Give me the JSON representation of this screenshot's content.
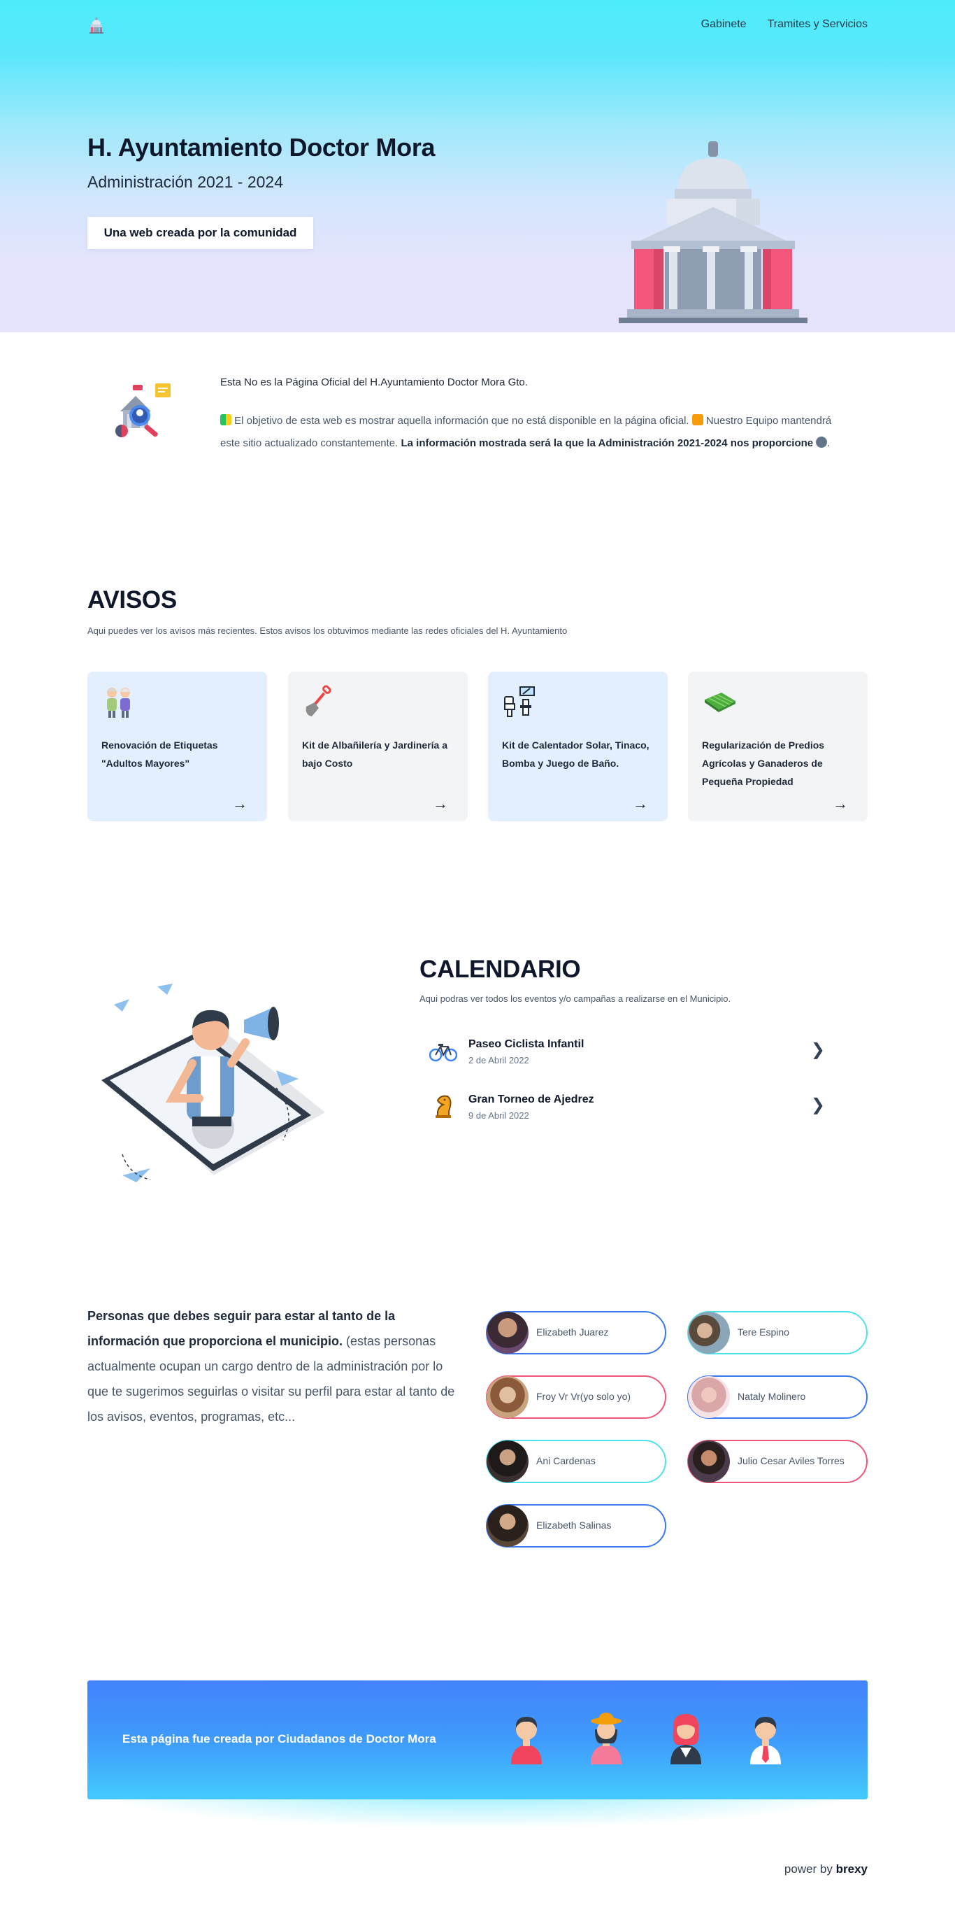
{
  "nav": {
    "logo_icon": "capitol-logo-icon",
    "links": [
      "Gabinete",
      "Tramites y Servicios"
    ]
  },
  "hero": {
    "title": "H. Ayuntamiento Doctor Mora",
    "subtitle": "Administración 2021 - 2024",
    "button": "Una web creada por la comunidad",
    "illustration": "capitol-building-icon"
  },
  "info": {
    "title": "Esta No es la Página Oficial del H.Ayuntamiento Doctor Mora Gto.",
    "body_1": "El objetivo de esta web es mostrar aquella información que no está disponible en la página oficial.",
    "body_2": "Nuestro Equipo mantendrá este sitio actualizado constantemente.",
    "body_bold": "La información mostrada será la que la Administración 2021-2024 nos proporcione",
    "body_end": "."
  },
  "avisos": {
    "title": "AVISOS",
    "subtitle": "Aqui puedes ver los avisos más recientes. Estos avisos los obtuvimos mediante las redes oficiales del H. Ayuntamiento",
    "cards": [
      {
        "label": "Renovación de Etiquetas \"Adultos Mayores\"",
        "icon": "elderly-couple-icon",
        "arrow": "→"
      },
      {
        "label": "Kit de Albañilería y Jardinería a bajo Costo",
        "icon": "shovel-icon",
        "arrow": "→"
      },
      {
        "label": "Kit de Calentador Solar, Tinaco, Bomba y Juego de Baño.",
        "icon": "bathroom-kit-icon",
        "arrow": "→"
      },
      {
        "label": "Regularización de Predios Agrícolas y Ganaderos de Pequeña Propiedad",
        "icon": "field-icon",
        "arrow": "→"
      }
    ]
  },
  "calendario": {
    "title": "CALENDARIO",
    "subtitle": "Aqui podras ver todos los eventos y/o campañas a realizarse en el Municipio.",
    "events": [
      {
        "name": "Paseo Ciclista Infantil",
        "date": "2 de Abril 2022",
        "icon": "bicycle-icon"
      },
      {
        "name": "Gran Torneo de Ajedrez",
        "date": "9 de Abril 2022",
        "icon": "chess-knight-icon"
      }
    ]
  },
  "personas": {
    "bold": "Personas que debes seguir para estar al tanto de la información que proporciona el municipio.",
    "rest": " (estas personas actualmente ocupan un cargo dentro de la administración por lo que te sugerimos seguirlas o visitar su perfil para estar al tanto de los avisos, eventos, programas, etc...",
    "people": [
      {
        "name": "Elizabeth Juarez",
        "accent": "#3a78f0"
      },
      {
        "name": "Tere Espino",
        "accent": "#4ee2ec"
      },
      {
        "name": "Froy Vr Vr(yo solo yo)",
        "accent": "#f0557a"
      },
      {
        "name": "Nataly Molinero",
        "accent": "#3a78f0"
      },
      {
        "name": "Ani Cardenas",
        "accent": "#4ee2ec"
      },
      {
        "name": "Julio Cesar Aviles Torres",
        "accent": "#f0557a"
      },
      {
        "name": "Elizabeth Salinas",
        "accent": "#3a78f0"
      }
    ]
  },
  "banner": {
    "text": "Esta página fue creada por Ciudadanos de Doctor Mora"
  },
  "footer": {
    "power_prefix": "power by",
    "power_brand": "brexy"
  },
  "colors": {
    "hero_top": "#4dedfb",
    "hero_bottom": "#e6e4fd",
    "card_blue": "#e4effe",
    "card_gray": "#f3f4f6",
    "banner_start": "#4282fb",
    "banner_end": "#43cafd"
  }
}
